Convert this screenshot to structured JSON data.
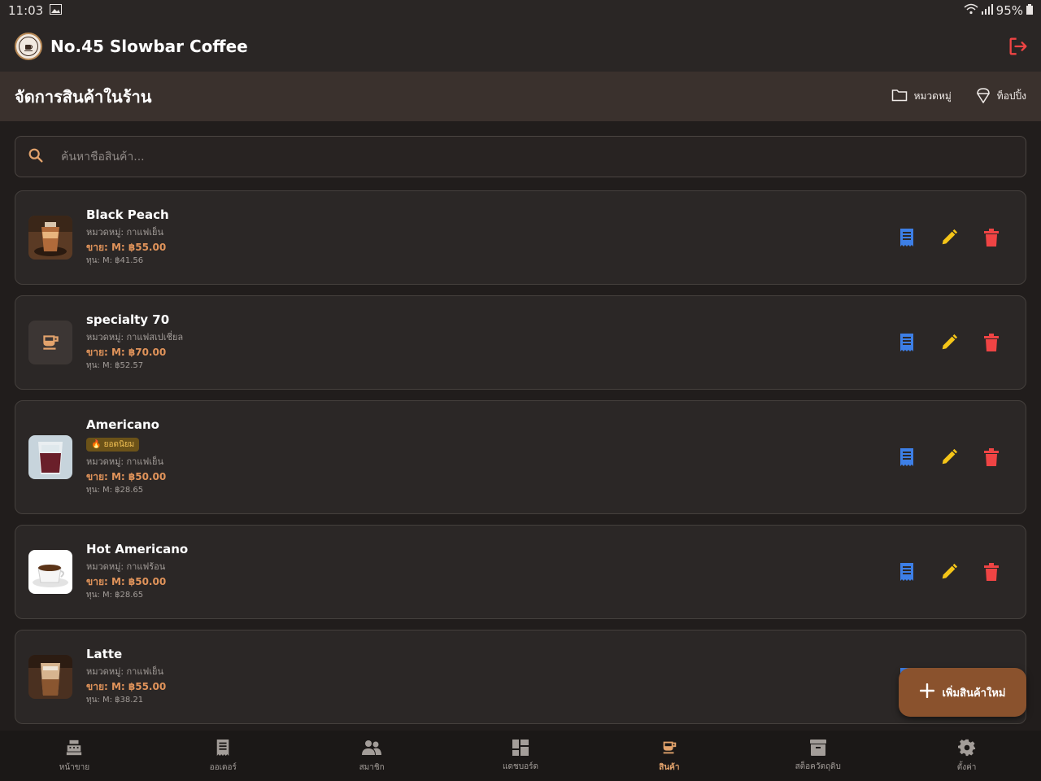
{
  "status": {
    "time": "11:03",
    "battery": "95%"
  },
  "app": {
    "title": "No.45 Slowbar Coffee"
  },
  "header": {
    "title": "จัดการสินค้าในร้าน",
    "actions": [
      {
        "label": "หมวดหมู่",
        "icon": "folder-icon"
      },
      {
        "label": "ท็อปปิ้ง",
        "icon": "ice-cream-icon"
      }
    ]
  },
  "search": {
    "placeholder": "ค้นหาชื่อสินค้า..."
  },
  "products": [
    {
      "name": "Black Peach",
      "category": "หมวดหมู่: กาแฟเย็น",
      "price": "ขาย: M: ฿55.00",
      "cost": "ทุน: M: ฿41.56",
      "thumb": "iced-coffee-photo"
    },
    {
      "name": "specialty 70",
      "category": "หมวดหมู่: กาแฟสเปเชี่ยล",
      "price": "ขาย: M: ฿70.00",
      "cost": "ทุน: M: ฿52.57",
      "thumb": "coffee-cup-placeholder-icon"
    },
    {
      "name": "Americano",
      "badge": "🔥 ยอดนิยม",
      "category": "หมวดหมู่: กาแฟเย็น",
      "price": "ขาย: M: ฿50.00",
      "cost": "ทุน: M: ฿28.65",
      "thumb": "iced-americano-photo"
    },
    {
      "name": "Hot Americano",
      "category": "หมวดหมู่: กาแฟร้อน",
      "price": "ขาย: M: ฿50.00",
      "cost": "ทุน: M: ฿28.65",
      "thumb": "hot-coffee-photo"
    },
    {
      "name": "Latte",
      "category": "หมวดหมู่: กาแฟเย็น",
      "price": "ขาย: M: ฿55.00",
      "cost": "ทุน: M: ฿38.21",
      "thumb": "iced-latte-photo"
    }
  ],
  "fab": {
    "label": "เพิ่มสินค้าใหม่"
  },
  "nav": [
    {
      "label": "หน้าขาย",
      "icon": "cash-register-icon"
    },
    {
      "label": "ออเดอร์",
      "icon": "receipt-icon"
    },
    {
      "label": "สมาชิก",
      "icon": "people-icon"
    },
    {
      "label": "แดชบอร์ด",
      "icon": "dashboard-icon"
    },
    {
      "label": "สินค้า",
      "icon": "coffee-icon",
      "active": true
    },
    {
      "label": "สต็อควัตถุดิบ",
      "icon": "archive-icon"
    },
    {
      "label": "ตั้งค่า",
      "icon": "gear-icon"
    }
  ],
  "colors": {
    "accent": "#e3a36c",
    "fab": "#8a522d",
    "recipe": "#3d7fe6",
    "edit": "#f5c518",
    "delete": "#ef4444",
    "price": "#e0935a"
  }
}
